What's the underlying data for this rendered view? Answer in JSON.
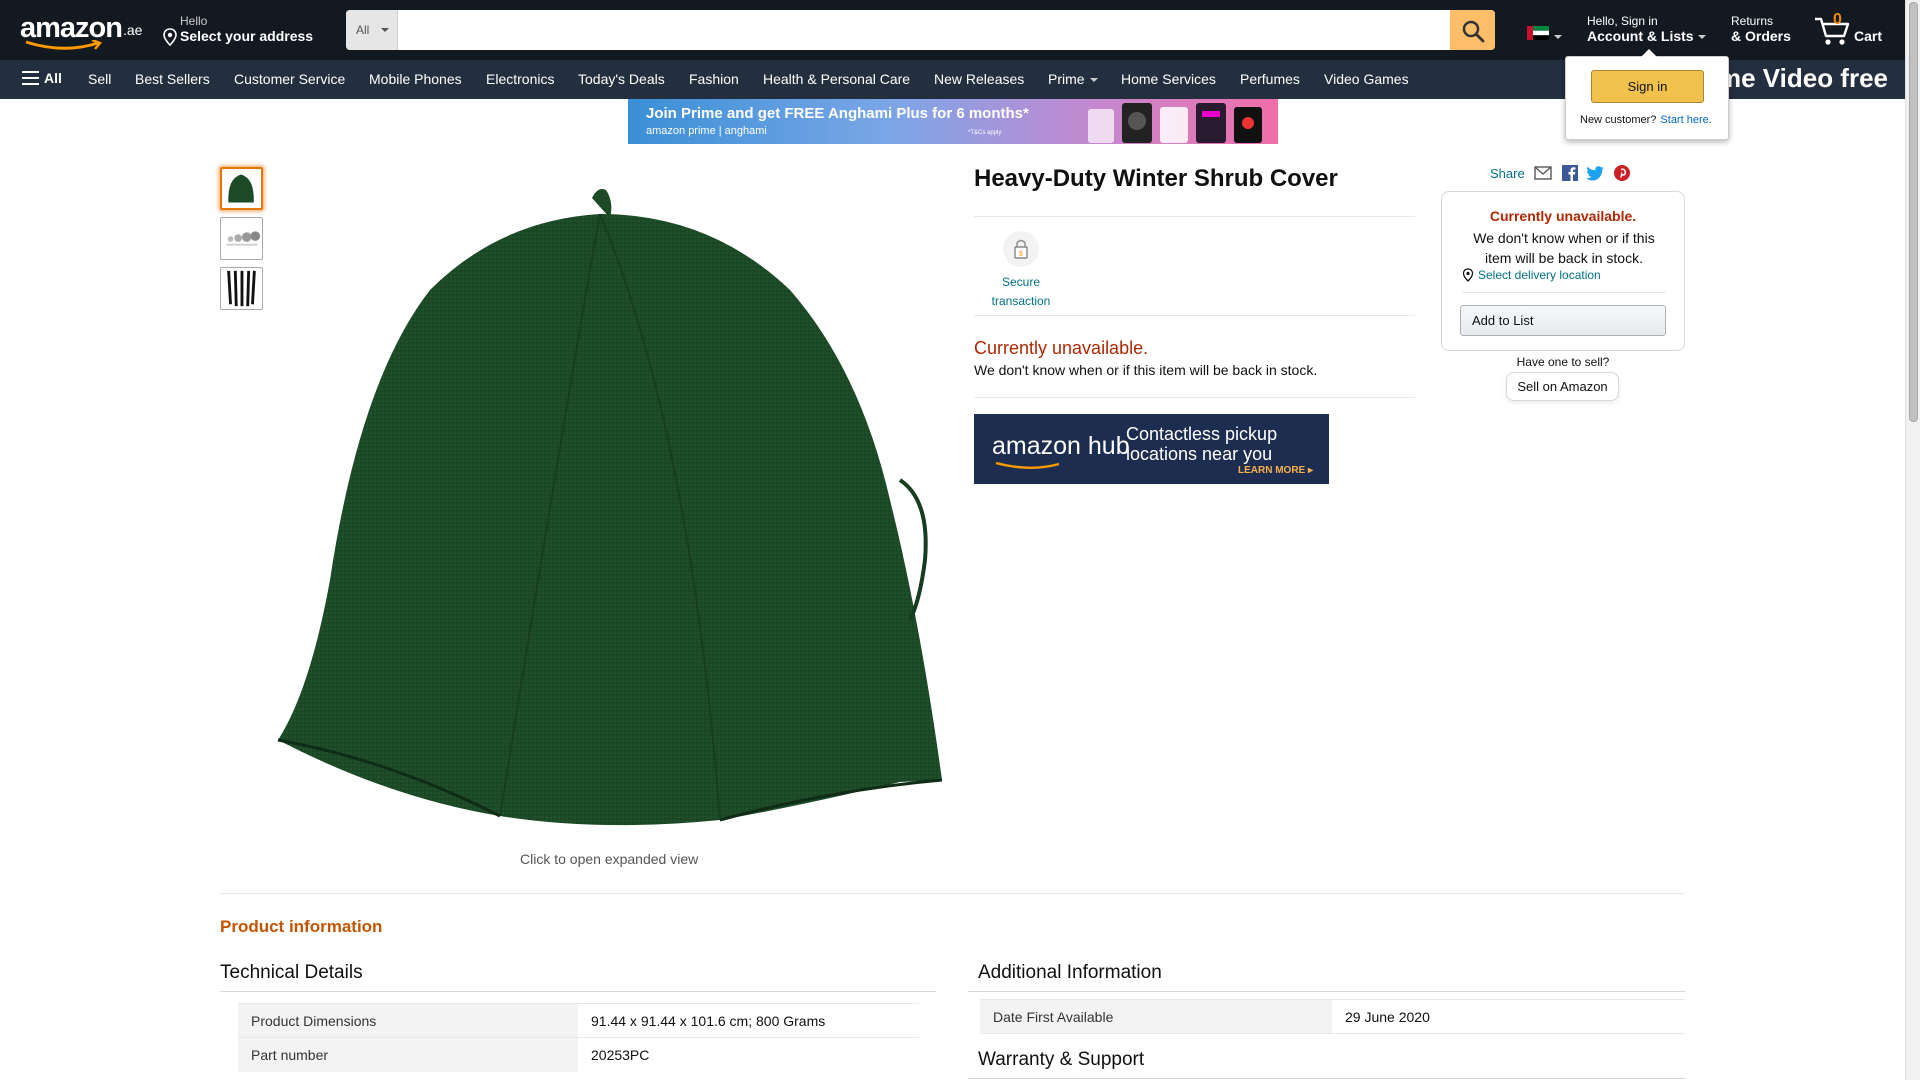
{
  "header": {
    "logo_text": "amazon",
    "logo_suffix": ".ae",
    "address_greeting": "Hello",
    "address_action": "Select your address",
    "search_category": "All",
    "search_placeholder": "",
    "account_greeting": "Hello, Sign in",
    "account_label": "Account & Lists",
    "returns_l1": "Returns",
    "returns_l2": "& Orders",
    "cart_count": "0",
    "cart_label": "Cart",
    "flag": "uae-flag-icon"
  },
  "subnav": {
    "all_label": "All",
    "items": [
      "Sell",
      "Best Sellers",
      "Customer Service",
      "Mobile Phones",
      "Electronics",
      "Today's Deals",
      "Fashion",
      "Health & Personal Care",
      "New Releases",
      "Prime",
      "Home Services",
      "Perfumes",
      "Video Games"
    ],
    "banner_text": "me Video free"
  },
  "signin_popover": {
    "button": "Sign in",
    "new_customer": "New customer?",
    "start_here": "Start here."
  },
  "promo": {
    "headline": "Join Prime and get FREE Anghami Plus for 6 months*",
    "brands": "amazon prime  |  anghami",
    "tc": "*T&Cs apply"
  },
  "product": {
    "title": "Heavy-Duty Winter Shrub Cover",
    "secure_label": "Secure transaction",
    "unavailable": "Currently unavailable.",
    "unavailable_sub": "We don't know when or if this item will be back in stock.",
    "click_hint": "Click to open expanded view",
    "color": "#1c4a26"
  },
  "hub_ad": {
    "brand": "amazon hub",
    "line1": "Contactless pickup",
    "line2": "locations near you",
    "cta": "LEARN MORE ▸"
  },
  "buybox": {
    "share": "Share",
    "unavailable": "Currently unavailable.",
    "unavailable_sub": "We don't know when or if this item will be back in stock.",
    "delivery": "Select delivery location",
    "add_to_list": "Add to List",
    "have_one": "Have one to sell?",
    "sell_on_amazon": "Sell on Amazon"
  },
  "info": {
    "heading": "Product information",
    "tech_heading": "Technical Details",
    "tech_rows": [
      {
        "k": "Product Dimensions",
        "v": "91.44 x 91.44 x 101.6 cm; 800 Grams"
      },
      {
        "k": "Part number",
        "v": "20253PC"
      }
    ],
    "add_heading": "Additional Information",
    "add_rows": [
      {
        "k": "Date First Available",
        "v": "29 June 2020"
      }
    ],
    "warranty_heading": "Warranty & Support"
  }
}
